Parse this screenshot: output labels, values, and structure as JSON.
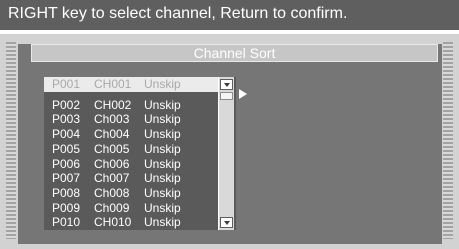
{
  "hint": {
    "text": "RIGHT key to select channel, Return to confirm."
  },
  "dialog": {
    "title": "Channel Sort"
  },
  "channels": [
    {
      "prog": "P001",
      "channel": "CH001",
      "status": "Unskip"
    },
    {
      "prog": "P002",
      "channel": "CH002",
      "status": "Unskip"
    },
    {
      "prog": "P003",
      "channel": "Ch003",
      "status": "Unskip"
    },
    {
      "prog": "P004",
      "channel": "Ch004",
      "status": "Unskip"
    },
    {
      "prog": "P005",
      "channel": "Ch005",
      "status": "Unskip"
    },
    {
      "prog": "P006",
      "channel": "Ch006",
      "status": "Unskip"
    },
    {
      "prog": "P007",
      "channel": "Ch007",
      "status": "Unskip"
    },
    {
      "prog": "P008",
      "channel": "Ch008",
      "status": "Unskip"
    },
    {
      "prog": "P009",
      "channel": "Ch009",
      "status": "Unskip"
    },
    {
      "prog": "P010",
      "channel": "CH010",
      "status": "Unskip"
    }
  ],
  "selected_index": 0,
  "icons": {
    "scroll_up": "scroll-up-icon",
    "scroll_down": "scroll-down-icon",
    "pointer": "right-arrow-icon"
  }
}
